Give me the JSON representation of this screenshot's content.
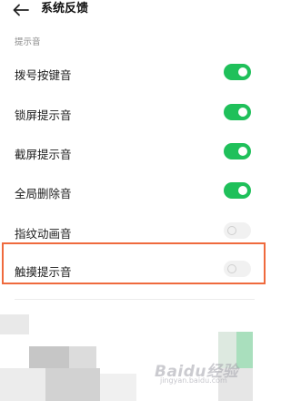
{
  "header": {
    "title": "系统反馈",
    "back_icon": "arrow-left-icon"
  },
  "section": {
    "title": "提示音"
  },
  "settings": [
    {
      "label": "拨号按键音",
      "enabled": true
    },
    {
      "label": "锁屏提示音",
      "enabled": true
    },
    {
      "label": "截屏提示音",
      "enabled": true
    },
    {
      "label": "全局删除音",
      "enabled": true
    },
    {
      "label": "指纹动画音",
      "enabled": false
    },
    {
      "label": "触摸提示音",
      "enabled": false
    }
  ],
  "watermark": {
    "text": "Baidu经验",
    "sub": "jingyan.baidu.com"
  },
  "colors": {
    "switch_on": "#1fc05a",
    "switch_off": "#f1f1f1",
    "highlight": "#ef6a3d"
  }
}
